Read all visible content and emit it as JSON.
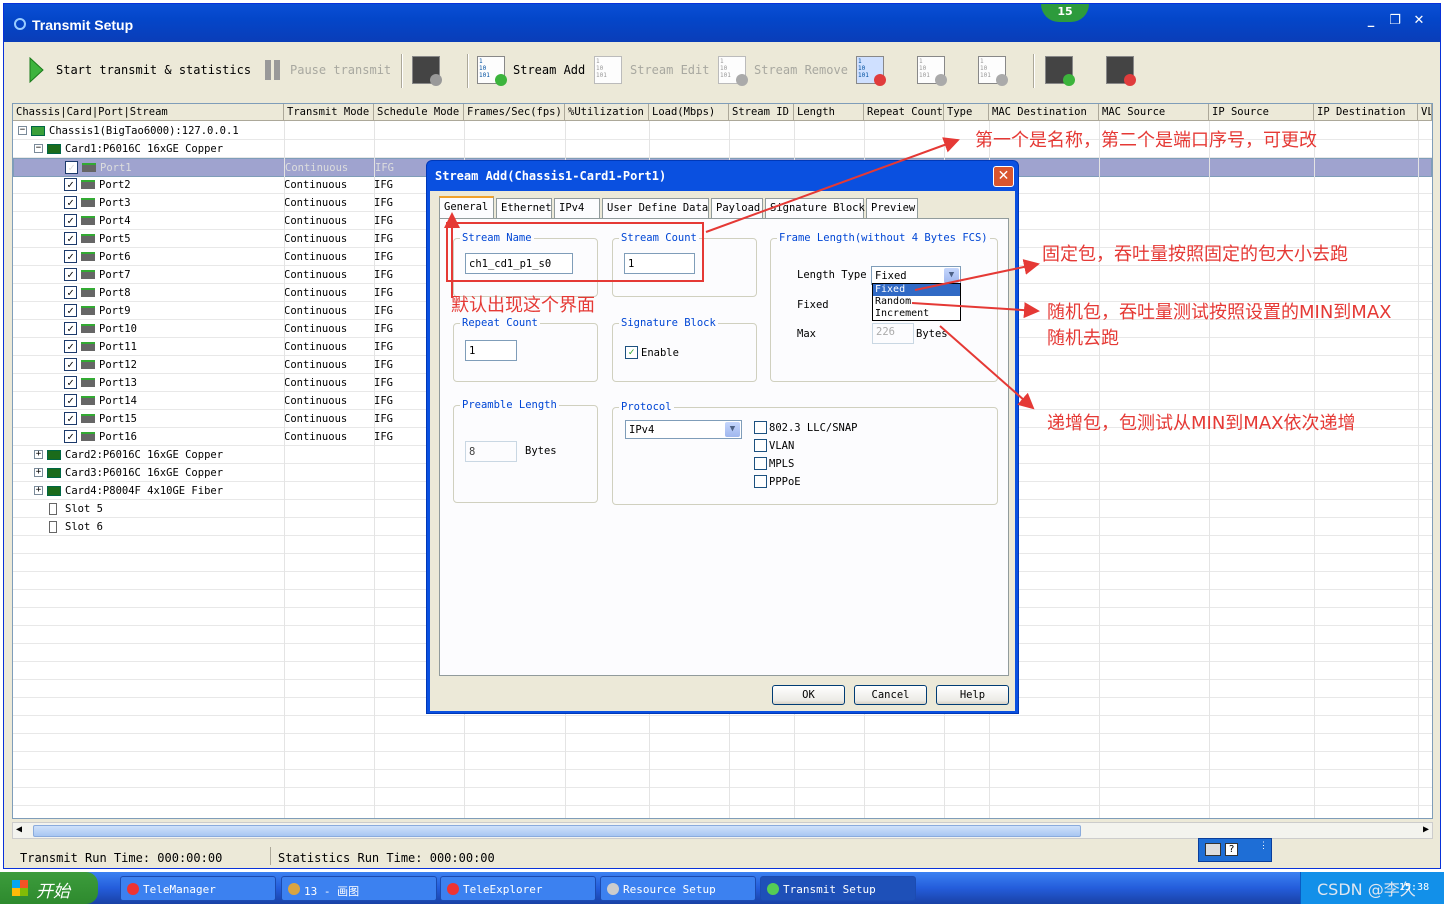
{
  "window": {
    "title": "Transmit Setup",
    "badge": "15",
    "controls": [
      "_",
      "❐",
      "✕"
    ]
  },
  "toolbar": {
    "start": "Start transmit & statistics",
    "pause": "Pause transmit",
    "stream_add": "Stream Add",
    "stream_edit": "Stream Edit",
    "stream_remove": "Stream Remove"
  },
  "columns": [
    "Chassis|Card|Port|Stream",
    "Transmit Mode",
    "Schedule Mode",
    "Frames/Sec(fps)",
    "%Utilization",
    "Load(Mbps)",
    "Stream ID",
    "Length",
    "Repeat Count",
    "Type",
    "MAC Destination",
    "MAC Source",
    "IP Source",
    "IP Destination",
    "VL"
  ],
  "tree": {
    "chassis": "Chassis1(BigTao6000):127.0.0.1",
    "card1": "Card1:P6016C 16xGE Copper",
    "ports": [
      "Port1",
      "Port2",
      "Port3",
      "Port4",
      "Port5",
      "Port6",
      "Port7",
      "Port8",
      "Port9",
      "Port10",
      "Port11",
      "Port12",
      "Port13",
      "Port14",
      "Port15",
      "Port16"
    ],
    "mode": "Continuous",
    "schedule": "IFG",
    "card2": "Card2:P6016C 16xGE Copper",
    "card3": "Card3:P6016C 16xGE Copper",
    "card4": "Card4:P8004F 4x10GE Fiber",
    "slot5": "Slot 5",
    "slot6": "Slot 6"
  },
  "status": {
    "transmit": "Transmit Run Time: 000:00:00",
    "statistics": "Statistics Run Time: 000:00:00"
  },
  "dialog": {
    "title": "Stream Add(Chassis1-Card1-Port1)",
    "tabs": [
      "General",
      "Ethernet",
      "IPv4",
      "User Define Data",
      "Payload",
      "Signature Block",
      "Preview"
    ],
    "stream_name_label": "Stream Name",
    "stream_name": "ch1_cd1_p1_s0",
    "stream_count_label": "Stream Count",
    "stream_count": "1",
    "frame_length_label": "Frame Length(without 4 Bytes FCS)",
    "length_type_label": "Length Type",
    "length_type": "Fixed",
    "length_options": [
      "Fixed",
      "Random",
      "Increment"
    ],
    "fixed_label": "Fixed",
    "max_label": "Max",
    "max_value": "226",
    "bytes": "Bytes",
    "repeat_count_label": "Repeat Count",
    "repeat_count": "1",
    "signature_block_label": "Signature Block",
    "enable": "Enable",
    "preamble_label": "Preamble Length",
    "preamble": "8",
    "protocol_label": "Protocol",
    "protocol": "IPv4",
    "protocol_opts": [
      "802.3 LLC/SNAP",
      "VLAN",
      "MPLS",
      "PPPoE"
    ],
    "ok": "OK",
    "cancel": "Cancel",
    "help": "Help"
  },
  "annotations": {
    "a1": "第一个是名称，第二个是端口序号，可更改",
    "a2": "默认出现这个界面",
    "a3": "固定包，吞吐量按照固定的包大小去跑",
    "a4": "随机包，吞吐量测试按照设置的MIN到MAX",
    "a4b": "随机去跑",
    "a5": "递增包，包测试从MIN到MAX依次递增"
  },
  "taskbar": {
    "start": "开始",
    "items": [
      "TeleManager",
      "13 - 画图",
      "TeleExplorer",
      "Resource Setup",
      "Transmit Setup"
    ],
    "watermark": "CSDN @李久",
    "clock": "15:38"
  },
  "colors": {
    "annotation": "#e53935",
    "selected_row": "#9fa3cf",
    "xp_blue": "#0a50e0"
  }
}
